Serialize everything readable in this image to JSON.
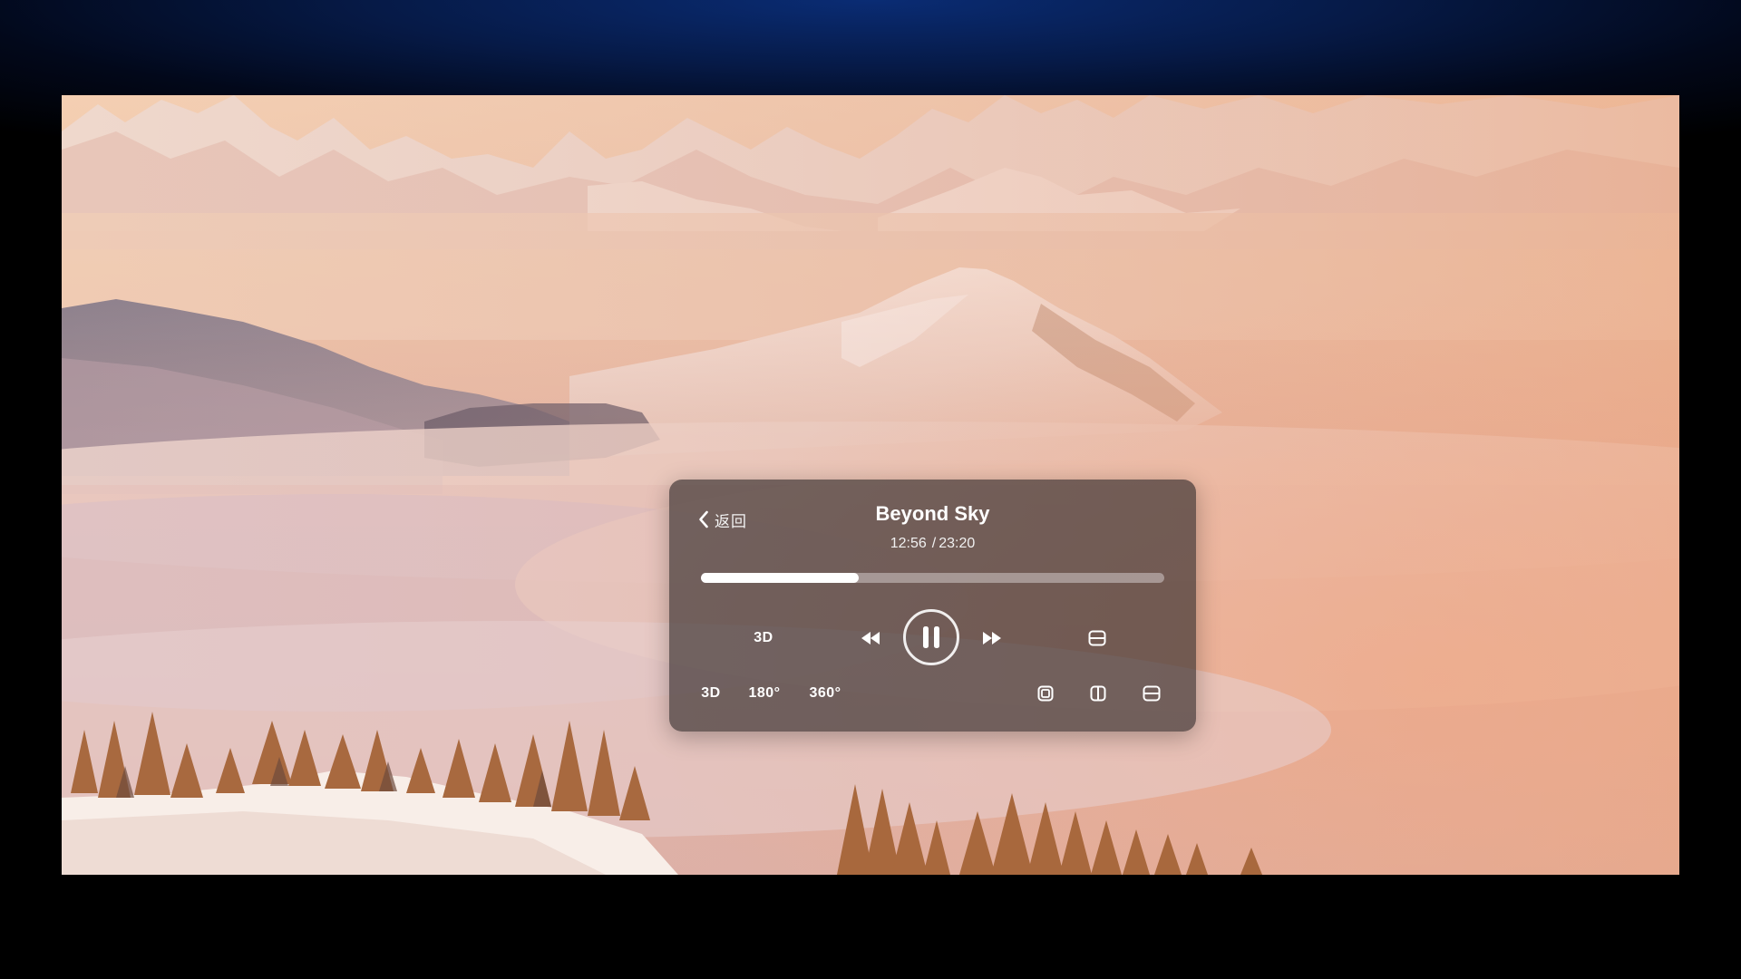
{
  "player": {
    "back_label": "返回",
    "title": "Beyond Sky",
    "current_time": "12:56",
    "separator": "/",
    "total_time": "23:20",
    "progress_percent": 34,
    "controls": {
      "mode_label": "3D",
      "rewind_icon": "rewind-icon",
      "play_state_icon": "pause-icon",
      "forward_icon": "fast-forward-icon",
      "screen_icon": "screen-mode-icon"
    },
    "formats": [
      "3D",
      "180°",
      "360°"
    ],
    "view_icons": [
      "single-view-icon",
      "side-by-side-icon",
      "top-bottom-icon"
    ]
  },
  "colors": {
    "panel_bg": "#342c2c",
    "progress_fill": "#ffffff",
    "progress_track": "#d2c8c8",
    "frame_bg_top": "#0a2c74"
  }
}
